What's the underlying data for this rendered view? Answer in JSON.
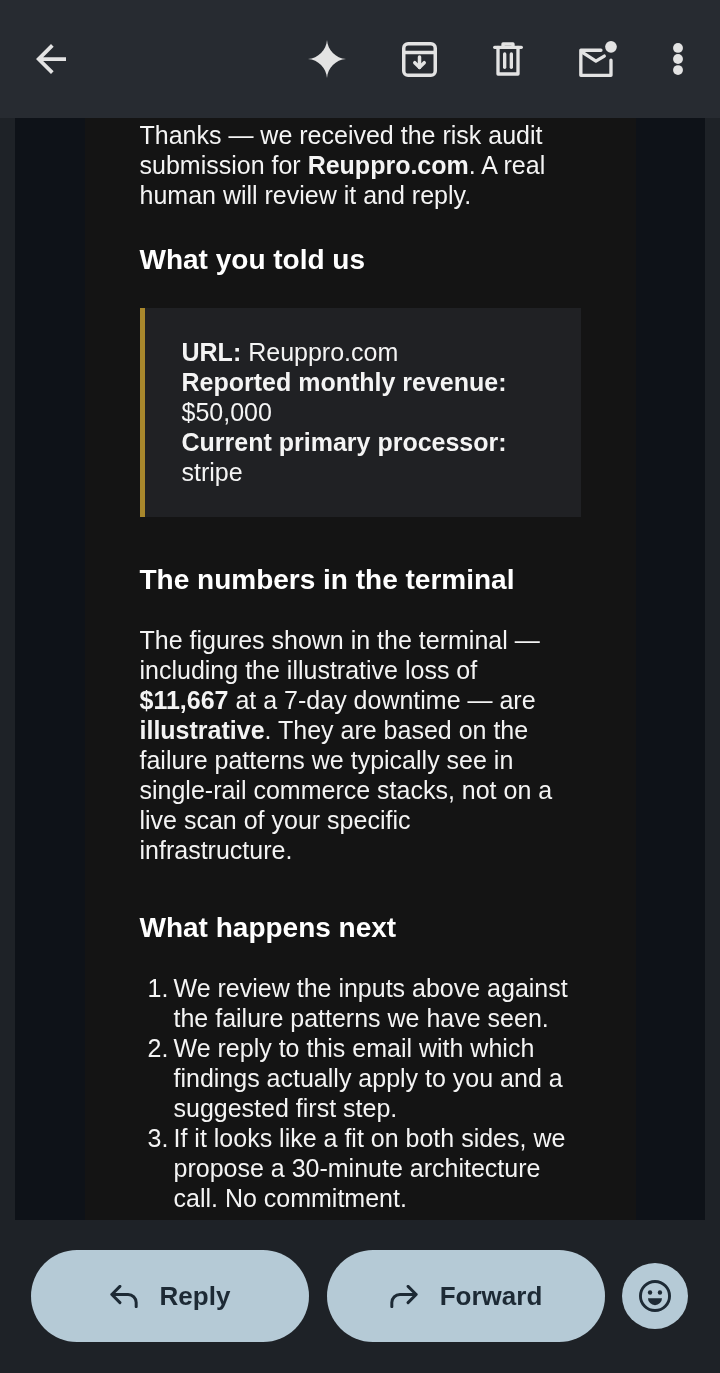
{
  "message": {
    "intro": "Thanks — we received the risk audit submission for **Reuppro.com**. A real human will review it and reply.",
    "sections": [
      {
        "kind": "quote",
        "heading": "What you told us",
        "fields": [
          {
            "label": "URL:",
            "value": "Reuppro.com"
          },
          {
            "label": "Reported monthly revenue:",
            "value": "$50,000"
          },
          {
            "label": "Current primary processor:",
            "value": "stripe"
          }
        ]
      },
      {
        "kind": "paragraph",
        "heading": "The numbers in the terminal",
        "text": "The figures shown in the terminal — including the illustrative loss of **$11,667** at a 7-day downtime — are **illustrative**. They are based on the failure patterns we typically see in single-rail commerce stacks, not on a live scan of your specific infrastructure."
      },
      {
        "kind": "steps",
        "heading": "What happens next",
        "steps": [
          {
            "number": "1.",
            "text": "We review the inputs above against the failure patterns we have seen."
          },
          {
            "number": "2.",
            "text": "We reply to this email with which findings actually apply to you and a suggested first step."
          },
          {
            "number": "3.",
            "text": "If it looks like a fit on both sides, we propose a 30-minute architecture call. No commitment."
          }
        ]
      }
    ]
  },
  "actions": [
    {
      "kind": "reply",
      "label": "Reply"
    },
    {
      "kind": "forward",
      "label": "Forward"
    }
  ]
}
